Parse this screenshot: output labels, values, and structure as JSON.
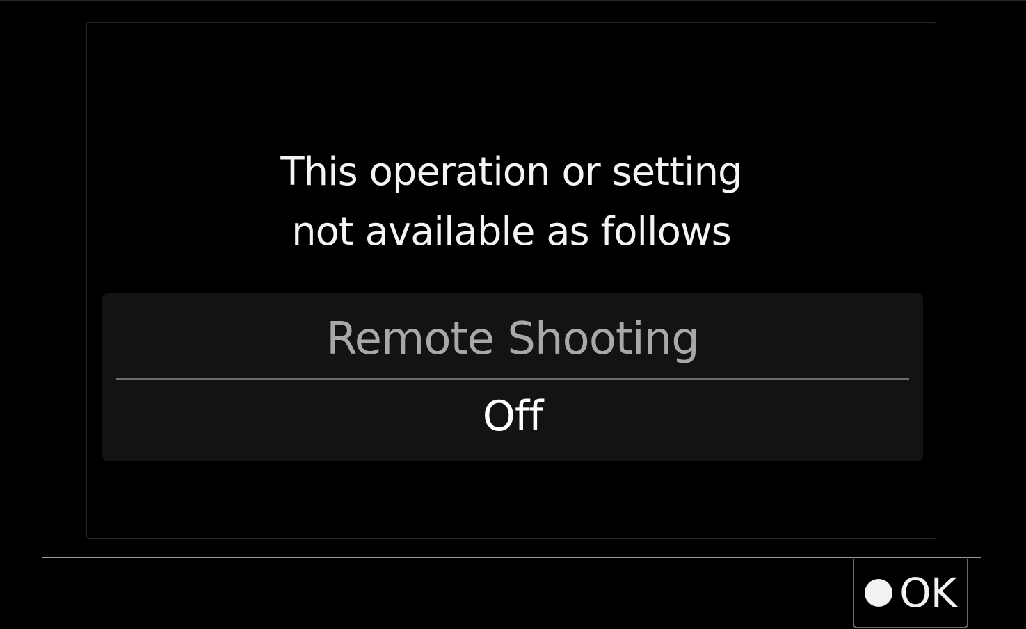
{
  "dialog": {
    "message_lines": [
      "This operation or setting",
      "not available as follows"
    ],
    "setting": {
      "name": "Remote Shooting",
      "value": "Off"
    }
  },
  "footer": {
    "ok_button": {
      "icon": "filled-circle-icon",
      "label": "OK"
    }
  },
  "colors": {
    "background": "#000000",
    "text": "#ffffff",
    "muted_text": "#a8a8a8",
    "panel": "#131313"
  }
}
